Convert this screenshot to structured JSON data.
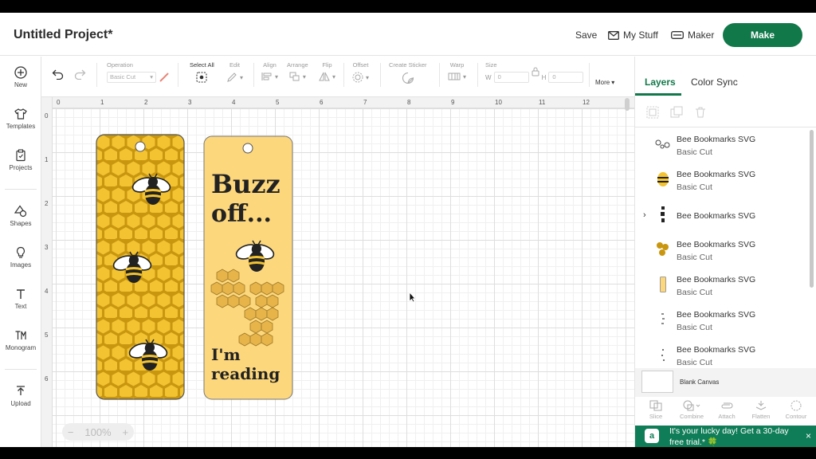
{
  "project_title": "Untitled Project*",
  "header": {
    "save": "Save",
    "my_stuff": "My Stuff",
    "maker": "Maker",
    "make": "Make"
  },
  "rail": [
    "New",
    "Templates",
    "Projects",
    "Shapes",
    "Images",
    "Text",
    "Monogram",
    "Upload"
  ],
  "toolbar": {
    "operation_label": "Operation",
    "operation_value": "Basic Cut",
    "select_all": "Select All",
    "edit": "Edit",
    "align": "Align",
    "arrange": "Arrange",
    "flip": "Flip",
    "offset": "Offset",
    "create_sticker": "Create Sticker",
    "warp": "Warp",
    "size": "Size",
    "w_label": "W",
    "w_value": "0",
    "h_label": "H",
    "h_value": "0",
    "more": "More"
  },
  "ruler": {
    "top": [
      "0",
      "1",
      "2",
      "3",
      "4",
      "5",
      "6",
      "7",
      "8",
      "9",
      "10",
      "11",
      "12"
    ],
    "left": [
      "0",
      "1",
      "2",
      "3",
      "4",
      "5",
      "6"
    ]
  },
  "zoom": {
    "level": "100%",
    "minus": "−",
    "plus": "+"
  },
  "bookmark_right": {
    "line1": "Buzz",
    "line2": "off...",
    "line3": "I'm",
    "line4": "reading"
  },
  "panel": {
    "tab_layers": "Layers",
    "tab_color_sync": "Color Sync",
    "layers": [
      {
        "name": "Bee Bookmarks SVG",
        "sub": "Basic Cut"
      },
      {
        "name": "Bee Bookmarks SVG",
        "sub": "Basic Cut"
      },
      {
        "name": "Bee Bookmarks SVG",
        "sub": ""
      },
      {
        "name": "Bee Bookmarks SVG",
        "sub": "Basic Cut"
      },
      {
        "name": "Bee Bookmarks SVG",
        "sub": "Basic Cut"
      },
      {
        "name": "Bee Bookmarks SVG",
        "sub": "Basic Cut"
      },
      {
        "name": "Bee Bookmarks SVG",
        "sub": "Basic Cut"
      }
    ],
    "blank_canvas": "Blank Canvas",
    "actions": [
      "Slice",
      "Combine",
      "Attach",
      "Flatten",
      "Contour"
    ]
  },
  "promo": {
    "text": "It's your lucky day! Get a 30-day free trial.* 🍀",
    "close": "×",
    "icon": "a"
  },
  "colors": {
    "accent": "#11784a",
    "honey": "#f1bd2c",
    "honey_dark": "#e0a819",
    "bookmark_light": "#fdd77c",
    "promo": "#0f7d57"
  }
}
